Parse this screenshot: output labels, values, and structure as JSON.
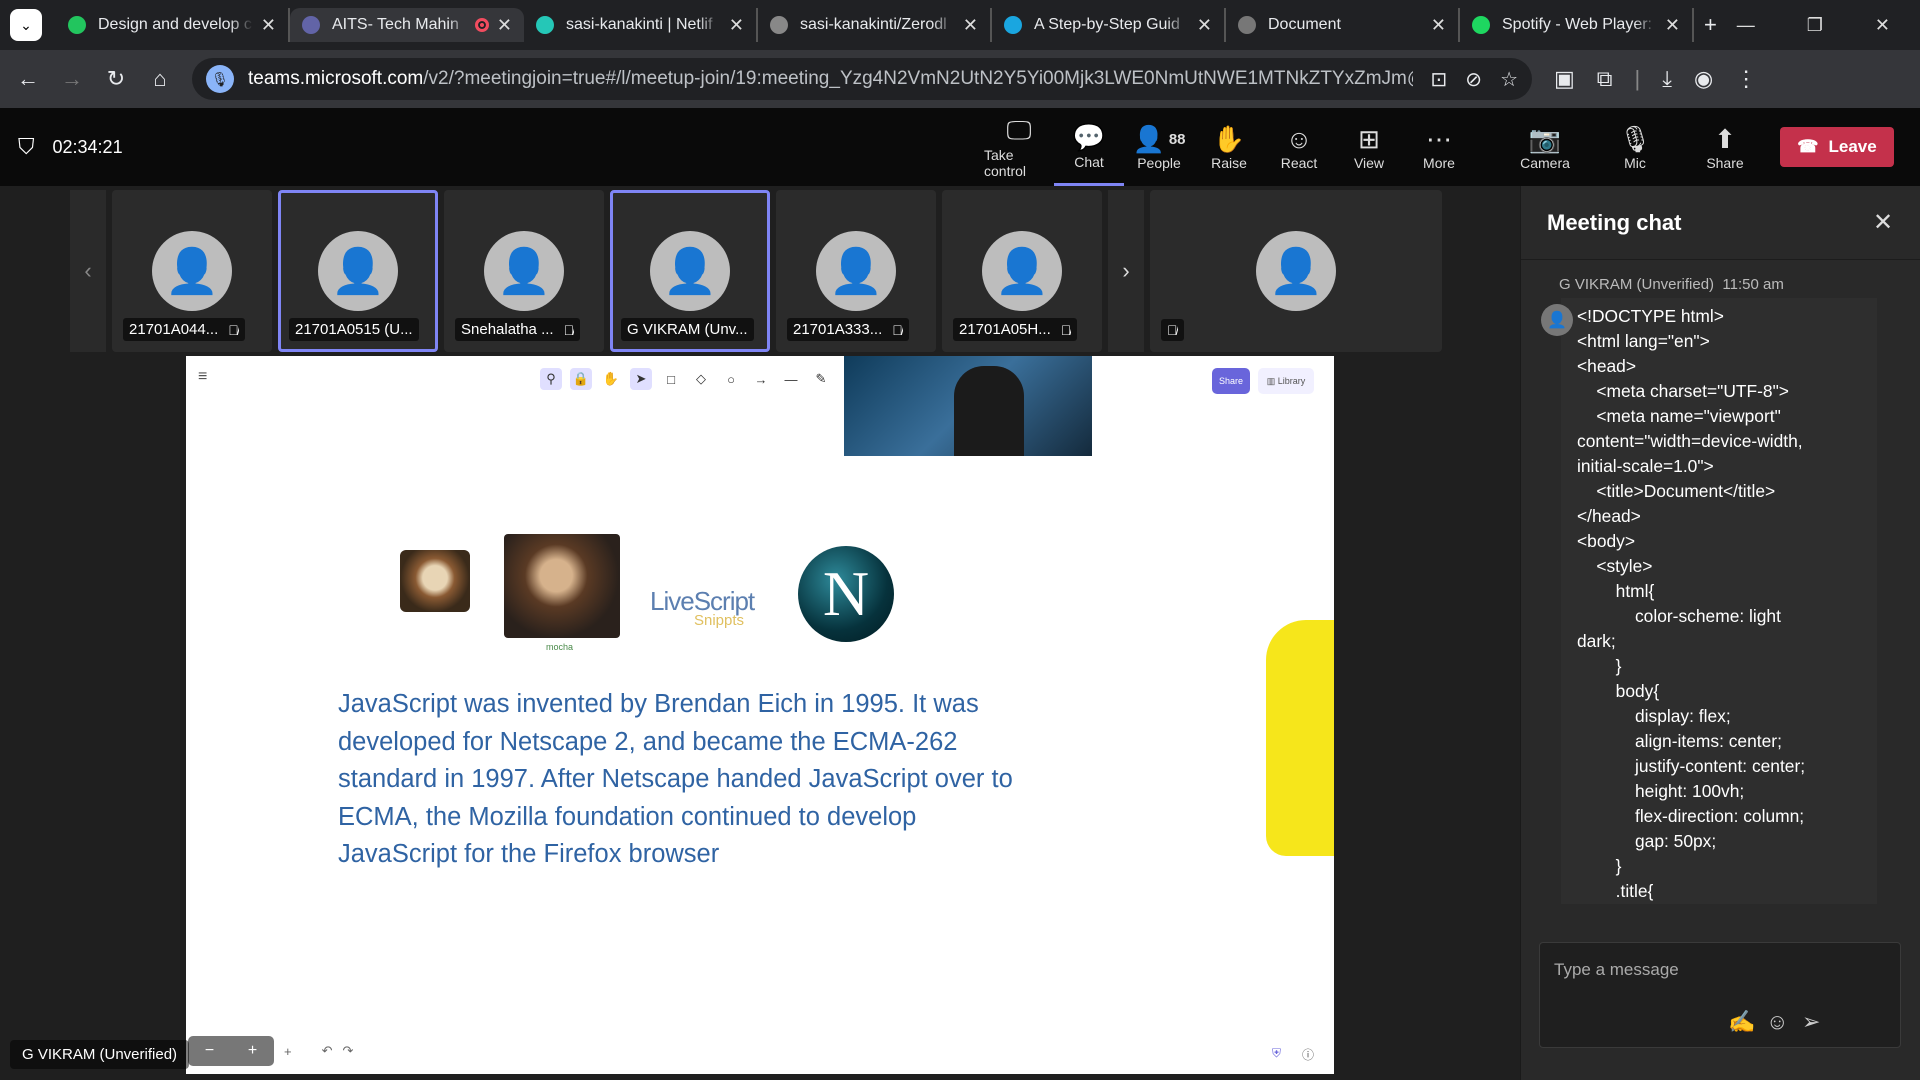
{
  "browser": {
    "tabs": [
      {
        "title": "Design and develop c",
        "favicon_color": "#22c55e",
        "active": false
      },
      {
        "title": "AITS- Tech Mahin",
        "favicon_color": "#6264a7",
        "active": true
      },
      {
        "title": "sasi-kanakinti | Netlif",
        "favicon_color": "#25c7b7",
        "active": false
      },
      {
        "title": "sasi-kanakinti/Zerodl",
        "favicon_color": "#888888",
        "active": false
      },
      {
        "title": "A Step-by-Step Guid",
        "favicon_color": "#1aa6e0",
        "active": false
      },
      {
        "title": "Document",
        "favicon_color": "#777777",
        "active": false
      },
      {
        "title": "Spotify - Web Player:",
        "favicon_color": "#1ed760",
        "active": false
      }
    ],
    "url_domain": "teams.microsoft.com",
    "url_path": "/v2/?meetingjoin=true#/l/meetup-join/19:meeting_Yzg4N2VmN2UtN2Y5Yi00Mjk3LWE0NmUtNWE1MTNkZTYxZmJm@thread.v2/0?context=%..."
  },
  "meeting": {
    "timer": "02:34:21",
    "people_count": "88",
    "tools": [
      {
        "label": "Take control",
        "icon": "screen-share-icon"
      },
      {
        "label": "Chat",
        "icon": "chat-icon"
      },
      {
        "label": "People",
        "icon": "people-icon"
      },
      {
        "label": "Raise",
        "icon": "hand-icon"
      },
      {
        "label": "React",
        "icon": "smile-icon"
      },
      {
        "label": "View",
        "icon": "grid-icon"
      },
      {
        "label": "More",
        "icon": "more-icon"
      },
      {
        "label": "Camera",
        "icon": "camera-off-icon"
      },
      {
        "label": "Mic",
        "icon": "mic-off-icon"
      },
      {
        "label": "Share",
        "icon": "share-icon"
      }
    ],
    "leave_label": "Leave",
    "participants": [
      {
        "name": "21701A044...",
        "selected": false
      },
      {
        "name": "21701A0515 (U...",
        "selected": true
      },
      {
        "name": "Snehalatha ...",
        "selected": false
      },
      {
        "name": "G VIKRAM (Unv...",
        "selected": true
      },
      {
        "name": "21701A333...",
        "selected": false
      },
      {
        "name": "21701A05H...",
        "selected": false
      }
    ],
    "presenter_label": "G VIKRAM (Unverified)"
  },
  "shared_screen": {
    "share_btn": "Share",
    "library_btn": "Library",
    "image_caption": "mocha",
    "livescript_title": "LiveScript",
    "livescript_sub": "Snippts",
    "netscape_letter": "N",
    "paragraph": "JavaScript was invented by Brendan Eich in 1995. It was developed for Netscape 2, and became the ECMA-262 standard in 1997. After Netscape handed JavaScript over to ECMA, the Mozilla foundation continued to develop JavaScript for the Firefox browser"
  },
  "chat": {
    "title": "Meeting chat",
    "sender": "G VIKRAM (Unverified)",
    "time": "11:50 am",
    "message": "<!DOCTYPE html>\n<html lang=\"en\">\n<head>\n    <meta charset=\"UTF-8\">\n    <meta name=\"viewport\"\ncontent=\"width=device-width,\ninitial-scale=1.0\">\n    <title>Document</title>\n</head>\n<body>\n    <style>\n        html{\n            color-scheme: light\ndark;\n        }\n        body{\n            display: flex;\n            align-items: center;\n            justify-content: center;\n            height: 100vh;\n            flex-direction: column;\n            gap: 50px;\n        }\n        .title{",
    "compose_placeholder": "Type a message"
  }
}
